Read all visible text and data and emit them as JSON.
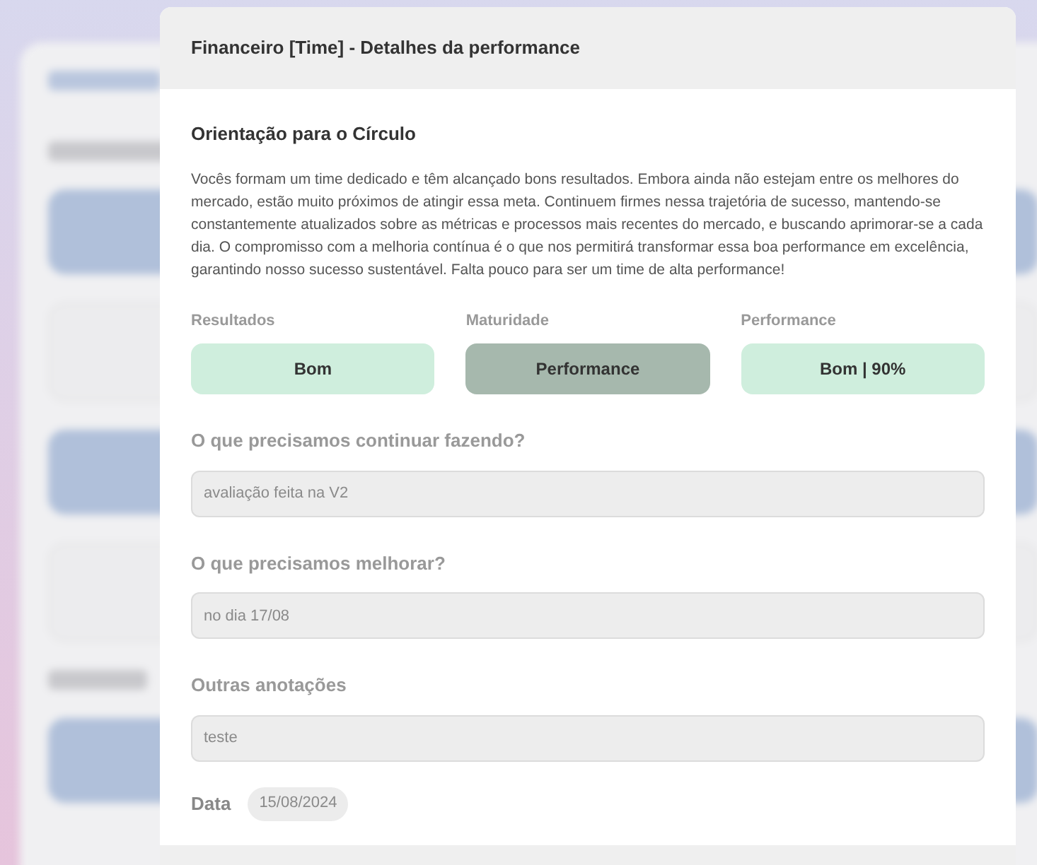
{
  "modal": {
    "title": "Financeiro [Time] - Detalhes da performance",
    "section_title": "Orientação para o Círculo",
    "description": "Vocês formam um time dedicado e têm alcançado bons resultados. Embora ainda não estejam entre os melhores do mercado, estão muito próximos de atingir essa meta. Continuem firmes nessa trajetória de sucesso, mantendo-se constantemente atualizados sobre as métricas e processos mais recentes do mercado, e buscando aprimorar-se a cada dia. O compromisso com a melhoria contínua é o que nos permitirá transformar essa boa performance em excelência, garantindo nosso sucesso sustentável. Falta pouco para ser um time de alta performance!",
    "ratings": [
      {
        "label": "Resultados",
        "value": "Bom",
        "color": "#cfeedd"
      },
      {
        "label": "Maturidade",
        "value": "Performance",
        "color": "#a6b8ad"
      },
      {
        "label": "Performance",
        "value": "Bom | 90%",
        "color": "#cfeedd"
      }
    ],
    "fields": [
      {
        "label": "O que precisamos continuar fazendo?",
        "value": "avaliação feita na V2"
      },
      {
        "label": "O que precisamos melhorar?",
        "value": "no dia 17/08"
      },
      {
        "label": "Outras anotações",
        "value": "teste"
      }
    ],
    "date": {
      "label": "Data",
      "value": "15/08/2024"
    }
  }
}
